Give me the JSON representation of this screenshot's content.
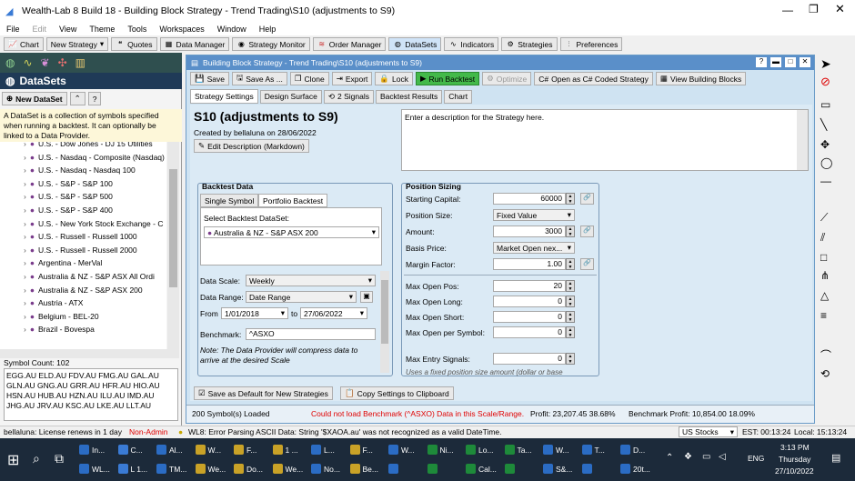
{
  "app": {
    "title": "Wealth-Lab 8 Build 18 - Building Block Strategy - Trend Trading\\S10 (adjustments to S9)"
  },
  "menu": [
    "File",
    "Edit",
    "View",
    "Theme",
    "Tools",
    "Workspaces",
    "Window",
    "Help"
  ],
  "toolbar": {
    "chart": "Chart",
    "new_strategy": "New Strategy",
    "quotes": "Quotes",
    "data_manager": "Data Manager",
    "strategy_monitor": "Strategy Monitor",
    "order_manager": "Order Manager",
    "datasets": "DataSets",
    "indicators": "Indicators",
    "strategies": "Strategies",
    "preferences": "Preferences"
  },
  "left": {
    "title": "DataSets",
    "new_dataset": "New DataSet",
    "info": "A DataSet is a collection of symbols specified when running a backtest. It can optionally be linked to a Data Provider.",
    "items": [
      "U.S. - Dow Jones - DJ 15 Utilities",
      "U.S. - Nasdaq - Composite (Nasdaq)",
      "U.S. - Nasdaq - Nasdaq 100",
      "U.S. - S&P - S&P 100",
      "U.S. - S&P - S&P 500",
      "U.S. - S&P - S&P 400",
      "U.S. - New York Stock Exchange - C",
      "U.S. - Russell - Russell 1000",
      "U.S. - Russell - Russell 2000",
      "Argentina - MerVal",
      "Australia & NZ - S&P ASX All Ordi",
      "Australia & NZ - S&P ASX 200",
      "Austria - ATX",
      "Belgium - BEL-20",
      "Brazil - Bovespa"
    ],
    "symbol_count": "Symbol Count: 102",
    "symbols": [
      "EGG.AU ELD.AU FDV.AU FMG.AU GAL.AU",
      "GLN.AU GNG.AU GRR.AU HFR.AU HIO.AU",
      "HSN.AU HUB.AU HZN.AU ILU.AU IMD.AU",
      "JHG.AU JRV.AU KSC.AU LKE.AU LLT.AU"
    ]
  },
  "doc": {
    "title": "Building Block Strategy - Trend Trading\\S10 (adjustments to S9)",
    "save": "Save",
    "save_as": "Save As ...",
    "clone": "Clone",
    "export": "Export",
    "lock": "Lock",
    "run": "Run Backtest",
    "optimize": "Optimize",
    "open_cs": "Open as C# Coded Strategy",
    "view_bb": "View Building Blocks",
    "tabs": [
      "Strategy Settings",
      "Design Surface",
      "2 Signals",
      "Backtest Results",
      "Chart"
    ],
    "strategy_name": "S10 (adjustments to S9)",
    "created": "Created by bellaluna on 28/06/2022",
    "edit_desc": "Edit Description (Markdown)",
    "desc_placeholder": "Enter a description for the Strategy here."
  },
  "backtest": {
    "title": "Backtest Data",
    "tab1": "Single Symbol",
    "tab2": "Portfolio Backtest",
    "select_label": "Select Backtest DataSet:",
    "dataset": "Australia & NZ - S&P ASX 200",
    "scale_label": "Data Scale:",
    "scale": "Weekly",
    "range_label": "Data Range:",
    "range": "Date Range",
    "from_label": "From",
    "from": "1/01/2018",
    "to_label": "to",
    "to": "27/06/2022",
    "bench_label": "Benchmark:",
    "bench": "^ASXO",
    "note": "Note: The Data Provider will compress data to arrive at the desired Scale"
  },
  "sizing": {
    "title": "Position Sizing",
    "capital_label": "Starting Capital:",
    "capital": "60000",
    "pos_size_label": "Position Size:",
    "pos_size": "Fixed Value",
    "amount_label": "Amount:",
    "amount": "3000",
    "basis_label": "Basis Price:",
    "basis": "Market Open nex...",
    "margin_label": "Margin Factor:",
    "margin": "1.00",
    "max_open_label": "Max Open Pos:",
    "max_open": "20",
    "max_long_label": "Max Open Long:",
    "max_long": "0",
    "max_short_label": "Max Open Short:",
    "max_short": "0",
    "max_sym_label": "Max Open per Symbol:",
    "max_sym": "0",
    "max_entry_label": "Max Entry Signals:",
    "max_entry": "0",
    "hint": "Uses a fixed position size amount (dollar or base"
  },
  "bottom": {
    "save_defaults": "Save as Default for New Strategies",
    "copy_clip": "Copy Settings to Clipboard"
  },
  "status": {
    "loaded": "200 Symbol(s) Loaded",
    "error": "Could not load Benchmark (^ASXO) Data in this Scale/Range.",
    "profit": "Profit: 23,207.45 38.68%",
    "bench_profit": "Benchmark Profit: 10,854.00 18.09%"
  },
  "appstatus": {
    "license": "bellaluna: License renews in 1 day",
    "admin": "Non-Admin",
    "wl8": "WL8: Error Parsing ASCII Data: String '$XAOA.au' was not recognized as a valid DateTime.",
    "market": "US Stocks",
    "est": "EST: 00:13:24",
    "local": "Local: 15:13:24"
  },
  "taskbar": {
    "row1": [
      "In...",
      "C...",
      "Al...",
      "W...",
      "F...",
      "1 ...",
      "L...",
      "F...",
      "W...",
      "Ni...",
      "Lo...",
      "Ta...",
      "W...",
      "T...",
      "D..."
    ],
    "row2": [
      "WL...",
      "L 1...",
      "TM...",
      "We...",
      "Do...",
      "We...",
      "No...",
      "Be...",
      "",
      "",
      "Cal...",
      "",
      "S&...",
      "",
      "20t..."
    ],
    "lang": "ENG",
    "time": "3:13 PM",
    "day": "Thursday",
    "date": "27/10/2022"
  }
}
